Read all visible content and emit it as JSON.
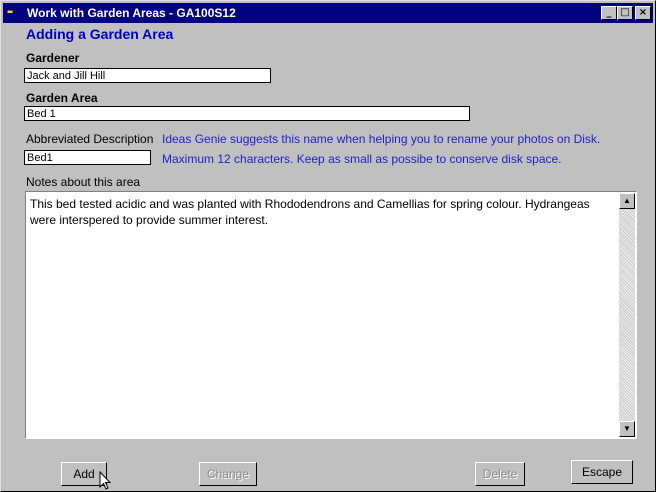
{
  "window": {
    "title": "Work with Garden Areas - GA100S12",
    "icon": "app-icon",
    "controls": {
      "minimize": "_",
      "maximize": "□",
      "close": "×"
    }
  },
  "form": {
    "heading": "Adding a Garden Area",
    "gardener": {
      "label": "Gardener",
      "value": "Jack and Jill Hill"
    },
    "garden_area": {
      "label": "Garden Area",
      "value": "Bed 1"
    },
    "abbrev": {
      "label": "Abbreviated Description",
      "value": "Bed1",
      "hint1": "Ideas Genie suggests this name when helping you to rename your photos on Disk.",
      "hint2": "Maximum 12 characters. Keep as small as possibe to conserve disk space."
    },
    "notes": {
      "label": "Notes about this area",
      "value": "This bed tested acidic and was planted with Rhododendrons and Camellias for spring colour. Hydrangeas were interspered to provide summer interest."
    }
  },
  "buttons": {
    "add": "Add",
    "change": "Change",
    "delete": "Delete",
    "escape": "Escape"
  },
  "colors": {
    "titlebar": "#000080",
    "heading": "#0000c0",
    "hint": "#2020c8",
    "face": "#c0c0c0"
  }
}
